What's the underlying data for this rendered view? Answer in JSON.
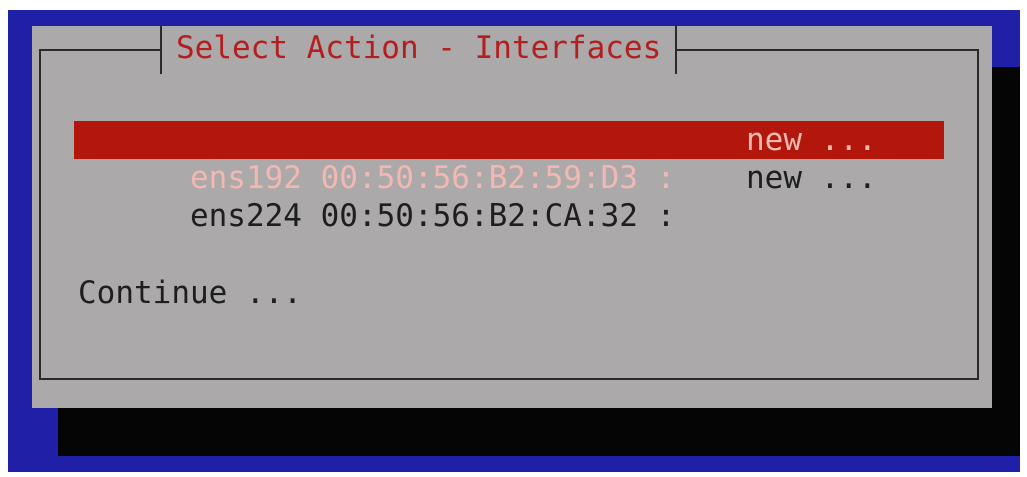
{
  "dialog": {
    "title": "Select Action - Interfaces",
    "items": [
      {
        "label": "ens192 00:50:56:B2:59:D3 :",
        "state": "new ...",
        "selected": true
      },
      {
        "label": "ens224 00:50:56:B2:CA:32 :",
        "state": "new ...",
        "selected": false
      }
    ],
    "continue_label": "Continue ..."
  },
  "colors": {
    "background": "#1f1fa8",
    "dialog": "#aba9a9",
    "shadow": "#050505",
    "title_text": "#b31f1f",
    "highlight": "#b3170c",
    "highlight_text": "#f2b8b2",
    "text": "#1e1e1e"
  }
}
